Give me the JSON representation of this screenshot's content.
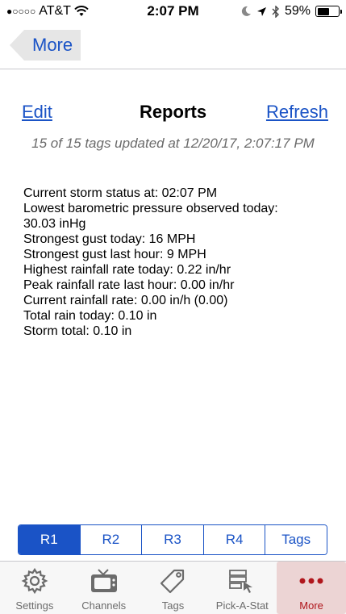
{
  "statusbar": {
    "carrier": "AT&T",
    "time": "2:07 PM",
    "battery": "59%",
    "battery_level": 0.59
  },
  "navbar": {
    "back_label": "More"
  },
  "header": {
    "edit_label": "Edit",
    "title": "Reports",
    "refresh_label": "Refresh",
    "updated_text": "15 of 15 tags updated at 12/20/17, 2:07:17 PM"
  },
  "report": {
    "status": "Current storm status at: 02:07 PM",
    "lowest_pressure_label": "Lowest barometric pressure observed today:",
    "lowest_pressure_value": "30.03 inHg",
    "gust_today": "Strongest gust today: 16 MPH",
    "gust_hour": "Strongest gust last hour: 9 MPH",
    "rain_rate_today": "Highest rainfall rate today: 0.22 in/hr",
    "rain_rate_hour": "Peak rainfall rate last hour: 0.00 in/hr",
    "rain_rate_current": "Current rainfall rate: 0.00 in/h (0.00)",
    "rain_total_today": "Total rain today: 0.10 in",
    "storm_total": "Storm total: 0.10 in"
  },
  "segments": [
    "R1",
    "R2",
    "R3",
    "R4",
    "Tags"
  ],
  "segment_selected": "R1",
  "tabs": [
    {
      "label": "Settings",
      "icon": "gear-icon"
    },
    {
      "label": "Channels",
      "icon": "tv-icon"
    },
    {
      "label": "Tags",
      "icon": "tag-icon"
    },
    {
      "label": "Pick-A-Stat",
      "icon": "stat-icon"
    },
    {
      "label": "More",
      "icon": "more-icon"
    }
  ],
  "tab_selected": "More",
  "colors": {
    "accent": "#1a53c6",
    "tab_active": "#b0161c",
    "tab_active_bg": "#ecd4d4"
  }
}
